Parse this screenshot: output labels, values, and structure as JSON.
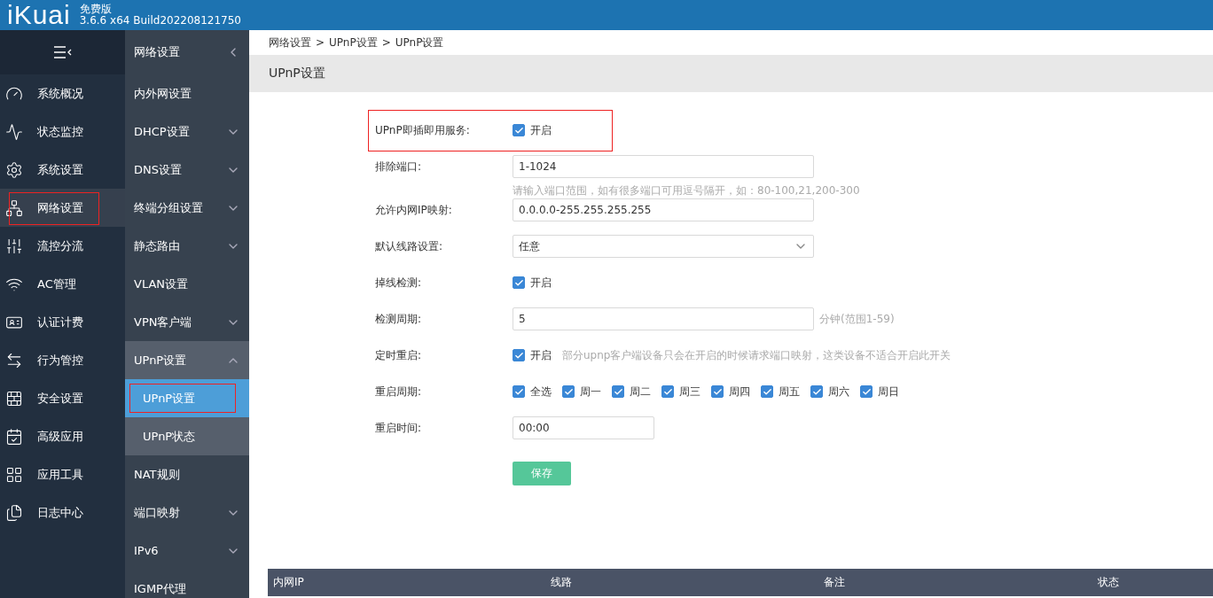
{
  "header": {
    "logo": "iKuai",
    "edition": "免费版",
    "version": "3.6.6 x64 Build202208121750"
  },
  "main_nav": {
    "items": [
      {
        "label": "系统概况",
        "selected": false,
        "highlighted": false
      },
      {
        "label": "状态监控",
        "selected": false,
        "highlighted": false
      },
      {
        "label": "系统设置",
        "selected": false,
        "highlighted": false
      },
      {
        "label": "网络设置",
        "selected": true,
        "highlighted": true
      },
      {
        "label": "流控分流",
        "selected": false,
        "highlighted": false
      },
      {
        "label": "AC管理",
        "selected": false,
        "highlighted": false
      },
      {
        "label": "认证计费",
        "selected": false,
        "highlighted": false
      },
      {
        "label": "行为管控",
        "selected": false,
        "highlighted": false
      },
      {
        "label": "安全设置",
        "selected": false,
        "highlighted": false
      },
      {
        "label": "高级应用",
        "selected": false,
        "highlighted": false
      },
      {
        "label": "应用工具",
        "selected": false,
        "highlighted": false
      },
      {
        "label": "日志中心",
        "selected": false,
        "highlighted": false
      }
    ]
  },
  "sub_nav": {
    "title": "网络设置",
    "items": [
      {
        "label": "内外网设置",
        "expandable": false,
        "expanded": false
      },
      {
        "label": "DHCP设置",
        "expandable": true,
        "expanded": false
      },
      {
        "label": "DNS设置",
        "expandable": true,
        "expanded": false
      },
      {
        "label": "终端分组设置",
        "expandable": true,
        "expanded": false
      },
      {
        "label": "静态路由",
        "expandable": true,
        "expanded": false
      },
      {
        "label": "VLAN设置",
        "expandable": false,
        "expanded": false
      },
      {
        "label": "VPN客户端",
        "expandable": true,
        "expanded": false
      },
      {
        "label": "UPnP设置",
        "expandable": true,
        "expanded": true,
        "children": [
          {
            "label": "UPnP设置",
            "selected": true,
            "highlighted": true
          },
          {
            "label": "UPnP状态",
            "selected": false,
            "highlighted": false
          }
        ]
      },
      {
        "label": "NAT规则",
        "expandable": false,
        "expanded": false
      },
      {
        "label": "端口映射",
        "expandable": true,
        "expanded": false
      },
      {
        "label": "IPv6",
        "expandable": true,
        "expanded": false
      },
      {
        "label": "IGMP代理",
        "expandable": false,
        "expanded": false
      }
    ]
  },
  "breadcrumb": [
    "网络设置",
    "UPnP设置",
    "UPnP设置"
  ],
  "breadcrumb_separator": ">",
  "page_title": "UPnP设置",
  "form": [
    {
      "kind": "checkbox",
      "label": "UPnP即插即用服务:",
      "option": "开启",
      "checked": true,
      "highlighted": true
    },
    {
      "kind": "input",
      "label": "排除端口:",
      "value": "1-1024",
      "hint": "请输入端口范围，如有很多端口可用逗号隔开，如：80-100,21,200-300"
    },
    {
      "kind": "input",
      "label": "允许内网IP映射:",
      "value": "0.0.0.0-255.255.255.255"
    },
    {
      "kind": "select",
      "label": "默认线路设置:",
      "value": "任意"
    },
    {
      "kind": "checkbox",
      "label": "掉线检测:",
      "option": "开启",
      "checked": true
    },
    {
      "kind": "input",
      "label": "检测周期:",
      "value": "5",
      "suffix": "分钟(范围1-59)"
    },
    {
      "kind": "checkbox",
      "label": "定时重启:",
      "option": "开启",
      "checked": true,
      "note": "部分upnp客户端设备只会在开启的时候请求端口映射，这类设备不适合开启此开关"
    },
    {
      "kind": "checkgroup",
      "label": "重启周期:",
      "options": [
        {
          "label": "全选",
          "checked": true
        },
        {
          "label": "周一",
          "checked": true
        },
        {
          "label": "周二",
          "checked": true
        },
        {
          "label": "周三",
          "checked": true
        },
        {
          "label": "周四",
          "checked": true
        },
        {
          "label": "周五",
          "checked": true
        },
        {
          "label": "周六",
          "checked": true
        },
        {
          "label": "周日",
          "checked": true
        }
      ]
    },
    {
      "kind": "short_input",
      "label": "重启时间:",
      "value": "00:00"
    }
  ],
  "save_button": "保存",
  "table": {
    "columns": [
      "内网IP",
      "线路",
      "备注",
      "状态"
    ]
  }
}
